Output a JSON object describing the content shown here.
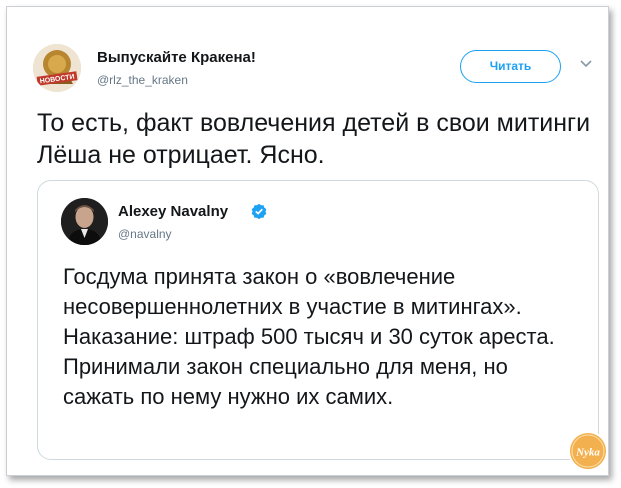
{
  "tweet": {
    "author_name": "Выпускайте Кракена!",
    "author_handle": "@rlz_the_kraken",
    "avatar_text": "НОВОСТИ",
    "follow_label": "Читать",
    "text": "То есть, факт вовлечения детей в свои митинги Лёша не отрицает. Ясно."
  },
  "quoted": {
    "author_name": "Alexey Navalny",
    "author_handle": "@navalny",
    "text": "Госдума принята закон о «вовлечение несовершеннолетних в участие в митингах». Наказание: штраф 500 тысяч и 30 суток ареста. Принимали закон специально для меня, но сажать по нему нужно их самих."
  },
  "watermark": {
    "text": "Nyka"
  },
  "colors": {
    "accent": "#1da1f2",
    "text": "#14171a",
    "secondary": "#657786",
    "border": "#cfd9de",
    "watermark": "#f0a23c"
  }
}
